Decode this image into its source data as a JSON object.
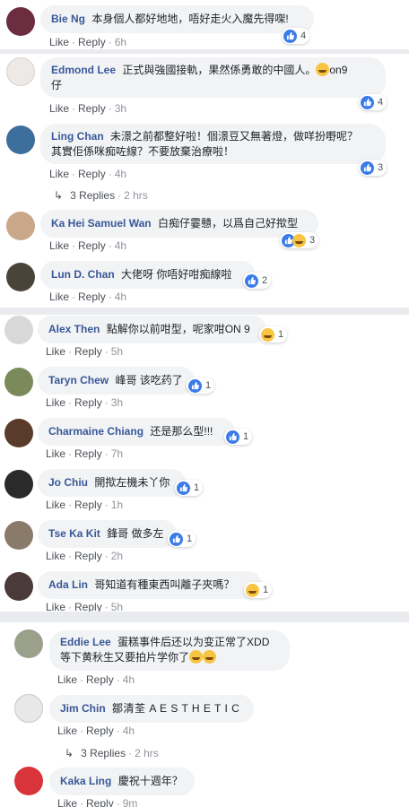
{
  "ui": {
    "like_label": "Like",
    "reply_label": "Reply",
    "dot": "·"
  },
  "comments": [
    {
      "name": "Bie Ng",
      "text": "本身個人都好地地，唔好走火入魔先得㗎!",
      "time": "6h",
      "reacts": "4"
    },
    {
      "name": "Edmond Lee",
      "text": "正式與強國接軌，果然係勇敢的中國人。",
      "text2": "on9",
      "line2": "仔",
      "time": "3h",
      "reacts": "4"
    },
    {
      "name": "Ling Chan",
      "text": "未澋之前都整好啦！個澋豆又無著燈，做咩扮嘢呢？",
      "line2": "其實佢係咪痴咗線？不要放棄治療啦！",
      "time": "4h",
      "reacts": "3",
      "replies_label": "3 Replies",
      "replies_time": "2 hrs"
    },
    {
      "name": "Ka Hei Samuel Wan",
      "text": "白痴仔霎戇，以爲自己好揿型",
      "time": "4h",
      "reacts": "3"
    },
    {
      "name": "Lun D. Chan",
      "text": "大佬呀 你唔好咁痴線啦",
      "time": "4h",
      "reacts": "2"
    },
    {
      "name": "Alex Then",
      "text": "點解你以前咁型，呢家咁ON 9",
      "time": "5h",
      "reacts": "1"
    },
    {
      "name": "Taryn Chew",
      "text": "峰哥 该吃药了",
      "time": "3h",
      "reacts": "1"
    },
    {
      "name": "Charmaine Chiang",
      "text": "还是那么型!!!",
      "time": "7h",
      "reacts": "1"
    },
    {
      "name": "Jo Chiu",
      "text": "開揿左機未丫你",
      "time": "1h",
      "reacts": "1"
    },
    {
      "name": "Tse Ka Kit",
      "text": "鋒哥 做多左",
      "time": "2h",
      "reacts": "1"
    },
    {
      "name": "Ada Lin",
      "text": "哥知道有種東西叫離子夾嗎？",
      "time": "5h",
      "reacts": "1"
    },
    {
      "name": "Eddie Lee",
      "text": "蛋糕事件后还以为变正常了XDD",
      "line2": "等下黄秋生又要拍片学你了",
      "time": "4h"
    },
    {
      "name": "Jim Chin",
      "text": "鄒清荃 A E S T H E T I C",
      "time": "4h",
      "replies_label": "3 Replies",
      "replies_time": "2 hrs"
    },
    {
      "name": "Kaka Ling",
      "text": "慶祝十週年？",
      "time": "9m"
    }
  ],
  "colors": {
    "name": "#385898",
    "bubble": "#f2f3f5",
    "like": "#3b7be8",
    "haha": "#f7c542",
    "band": "#e9ebee"
  },
  "icons": {
    "like": "thumbs-up-icon",
    "haha": "laughing-emoji-icon",
    "reply_arrow": "reply-arrow-icon"
  }
}
